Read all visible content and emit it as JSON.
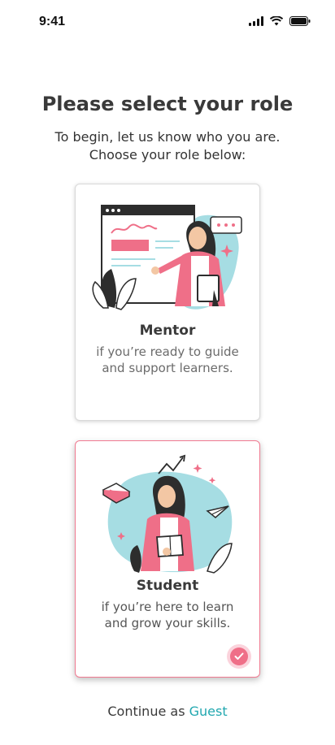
{
  "status_bar": {
    "time": "9:41",
    "icons": [
      "cellular-signal-icon",
      "wifi-icon",
      "battery-icon"
    ]
  },
  "header": {
    "title": "Please select your role",
    "subtitle_line1": "To begin, let us know who you are.",
    "subtitle_line2": "Choose your role below:"
  },
  "roles": [
    {
      "name": "Mentor",
      "desc_line1": "if you’re ready to guide",
      "desc_line2": "and support learners.",
      "selected": false
    },
    {
      "name": "Student",
      "desc_line1": "if you’re here to learn",
      "desc_line2": "and grow your skills.",
      "selected": true
    }
  ],
  "footer": {
    "prefix": "Continue as",
    "link": "Guest"
  },
  "colors": {
    "accent": "#ef6f88",
    "teal": "#22a8b0",
    "illustration_blue": "#a6dde3"
  }
}
